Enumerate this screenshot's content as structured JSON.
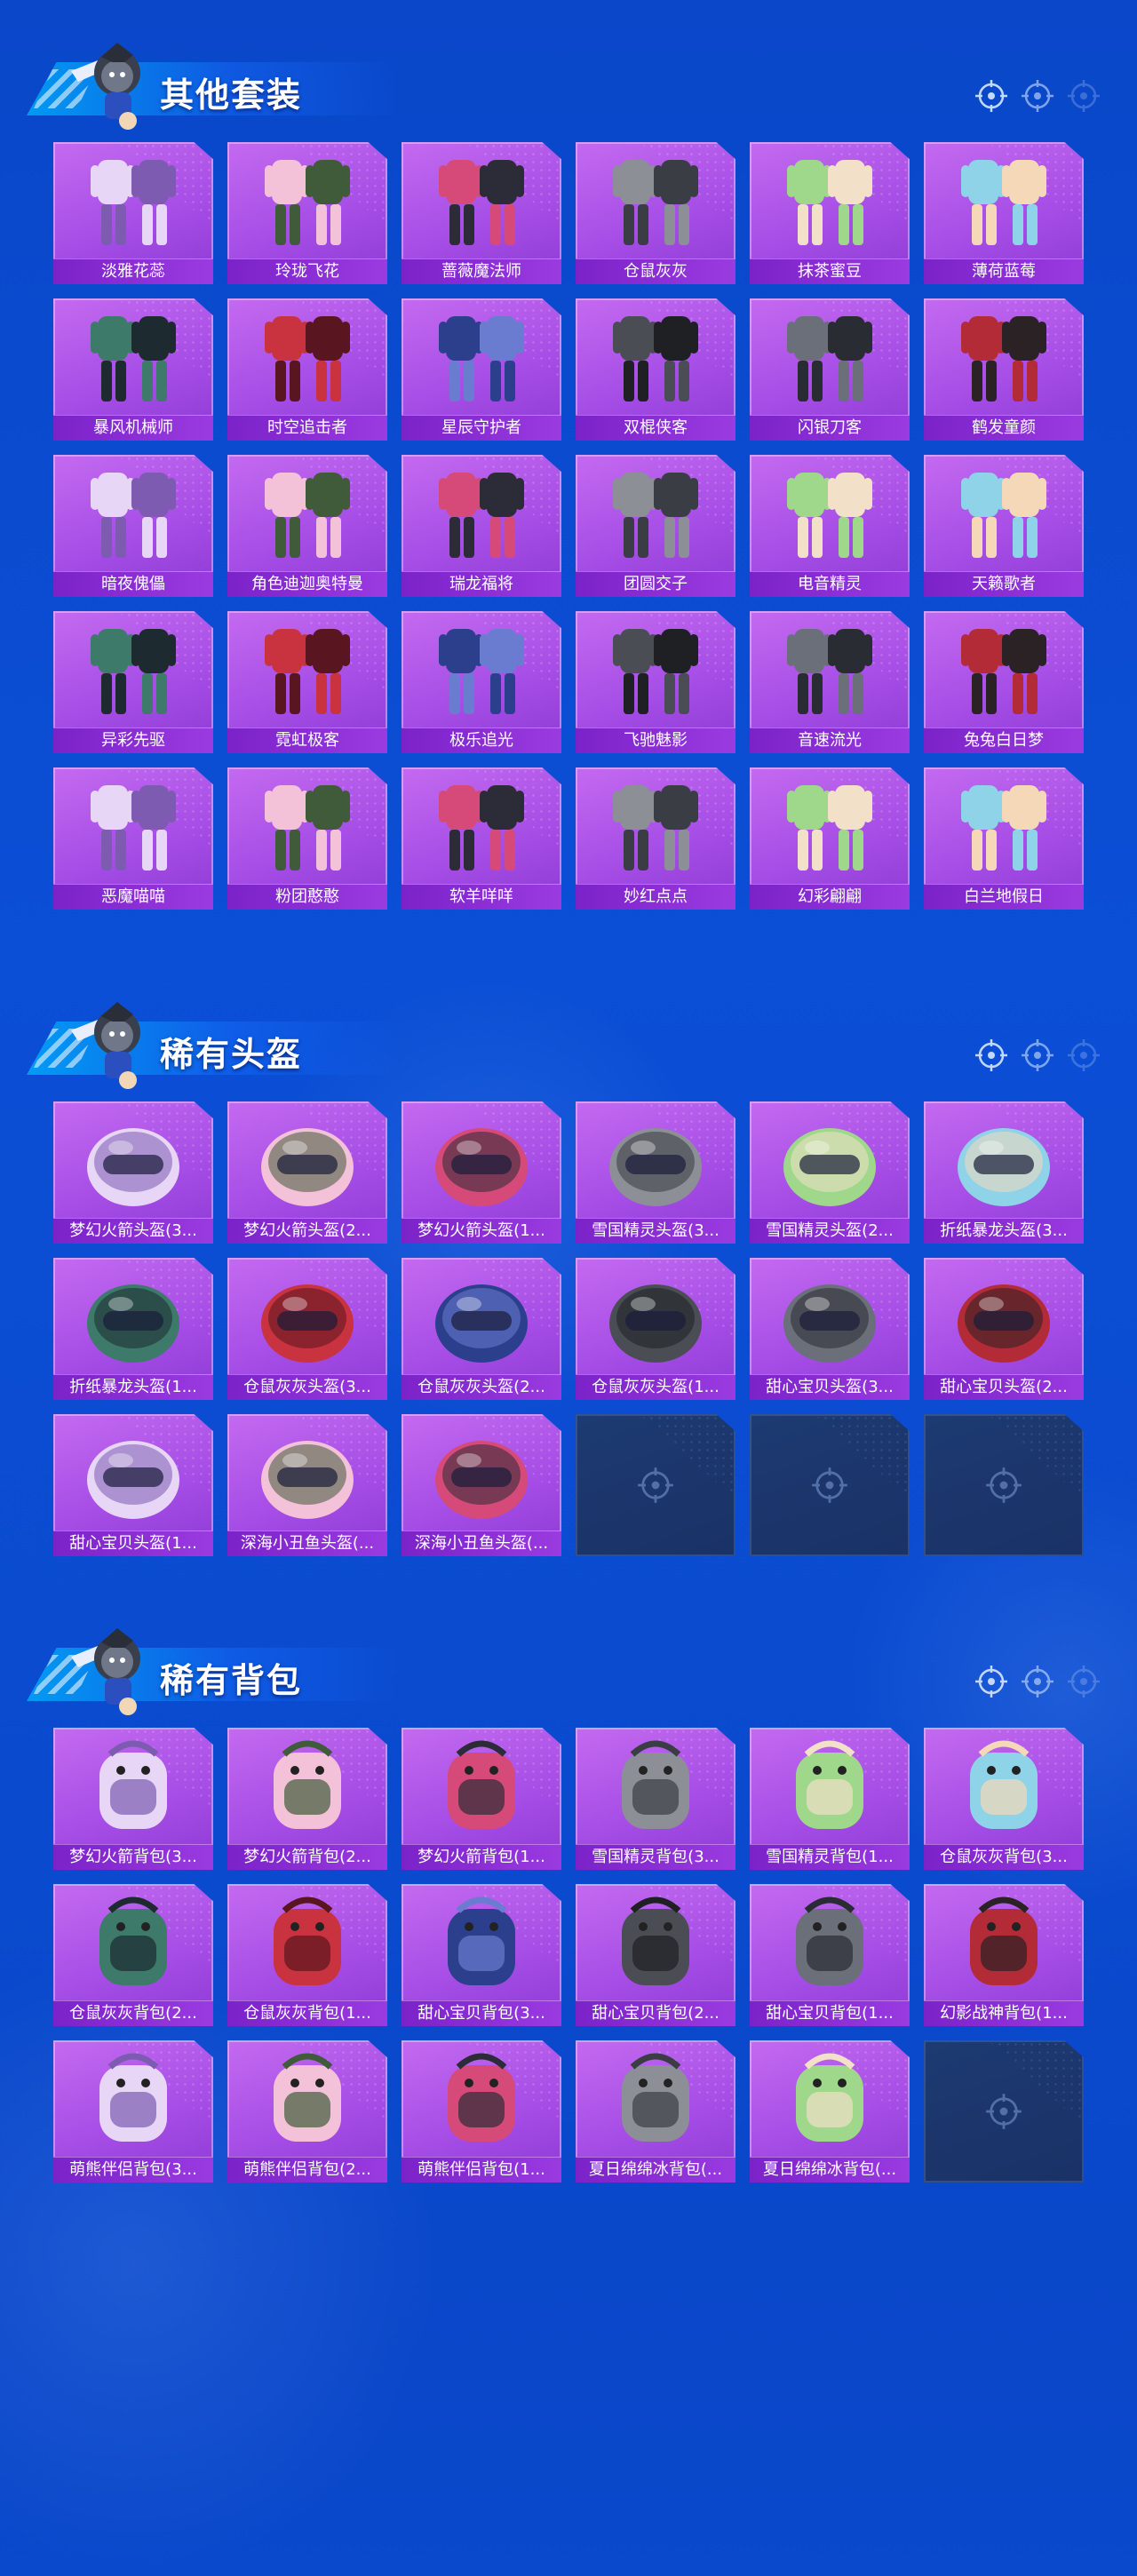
{
  "sections": [
    {
      "title": "其他套装",
      "items": [
        "淡雅花蕊",
        "玲珑飞花",
        "蔷薇魔法师",
        "仓鼠灰灰",
        "抹茶蜜豆",
        "薄荷蓝莓",
        "暴风机械师",
        "时空追击者",
        "星辰守护者",
        "双棍侠客",
        "闪银刀客",
        "鹤发童颜",
        "暗夜傀儡",
        "角色迪迦奥特曼",
        "瑞龙福将",
        "团圆交子",
        "电音精灵",
        "天籁歌者",
        "异彩先驱",
        "霓虹极客",
        "极乐追光",
        "飞驰魅影",
        "音速流光",
        "兔兔白日梦",
        "恶魔喵喵",
        "粉团憨憨",
        "软羊咩咩",
        "妙红点点",
        "幻彩翩翩",
        "白兰地假日"
      ],
      "empty_slots": 0
    },
    {
      "title": "稀有头盔",
      "items": [
        "梦幻火箭头盔(3...",
        "梦幻火箭头盔(2...",
        "梦幻火箭头盔(1...",
        "雪国精灵头盔(3...",
        "雪国精灵头盔(2...",
        "折纸暴龙头盔(3...",
        "折纸暴龙头盔(1...",
        "仓鼠灰灰头盔(3...",
        "仓鼠灰灰头盔(2...",
        "仓鼠灰灰头盔(1...",
        "甜心宝贝头盔(3...",
        "甜心宝贝头盔(2...",
        "甜心宝贝头盔(1...",
        "深海小丑鱼头盔(...",
        "深海小丑鱼头盔(..."
      ],
      "empty_slots": 3
    },
    {
      "title": "稀有背包",
      "items": [
        "梦幻火箭背包(3...",
        "梦幻火箭背包(2...",
        "梦幻火箭背包(1...",
        "雪国精灵背包(3...",
        "雪国精灵背包(1...",
        "仓鼠灰灰背包(3...",
        "仓鼠灰灰背包(2...",
        "仓鼠灰灰背包(1...",
        "甜心宝贝背包(3...",
        "甜心宝贝背包(2...",
        "甜心宝贝背包(1...",
        "幻影战神背包(1...",
        "萌熊伴侣背包(3...",
        "萌熊伴侣背包(2...",
        "萌熊伴侣背包(1...",
        "夏日绵绵冰背包(...",
        "夏日绵绵冰背包(..."
      ],
      "empty_slots": 1
    }
  ],
  "icons": {
    "mascot": "soldier-mascot-icon",
    "crosshair": "crosshair-icon",
    "empty": "crosshair-icon"
  },
  "colors": {
    "background": "#0b4fd6",
    "card": "#a64ee6",
    "label_bar": "#7b22c9",
    "empty_card": "#1d3a72"
  }
}
